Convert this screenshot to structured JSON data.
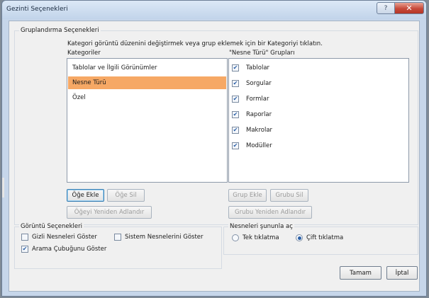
{
  "window": {
    "title": "Gezinti Seçenekleri",
    "help_glyph": "?",
    "close_glyph": "✕"
  },
  "grouping": {
    "section_label": "Gruplandırma Seçenekleri",
    "instructions": "Kategori görüntü düzenini değiştirmek veya grup eklemek için bir Kategoriyi tıklatın.",
    "categories_header": "Kategoriler",
    "groups_header": "\"Nesne Türü\" Grupları",
    "categories": [
      {
        "label": "Tablolar ve İlgili Görünümler",
        "selected": false
      },
      {
        "label": "Nesne Türü",
        "selected": true
      },
      {
        "label": "Özel",
        "selected": false
      }
    ],
    "groups": [
      {
        "label": "Tablolar",
        "checked": true
      },
      {
        "label": "Sorgular",
        "checked": true
      },
      {
        "label": "Formlar",
        "checked": true
      },
      {
        "label": "Raporlar",
        "checked": true
      },
      {
        "label": "Makrolar",
        "checked": true
      },
      {
        "label": "Modüller",
        "checked": true
      }
    ],
    "buttons": {
      "add_item": "Öğe Ekle",
      "delete_item": "Öğe Sil",
      "rename_item": "Öğeyi Yeniden Adlandır",
      "add_group": "Grup Ekle",
      "delete_group": "Grubu Sil",
      "rename_group": "Grubu Yeniden Adlandır"
    }
  },
  "display": {
    "section_label": "Görüntü Seçenekleri",
    "show_hidden": {
      "label": "Gizli Nesneleri Göster",
      "checked": false
    },
    "show_system": {
      "label": "Sistem Nesnelerini Göster",
      "checked": false
    },
    "show_search": {
      "label": "Arama Çubuğunu Göster",
      "checked": true
    }
  },
  "open_with": {
    "section_label": "Nesneleri şununla aç",
    "single_click": {
      "label": "Tek tıklatma",
      "selected": false
    },
    "double_click": {
      "label": "Çift tıklatma",
      "selected": true
    }
  },
  "footer": {
    "ok": "Tamam",
    "cancel": "İptal"
  },
  "colors": {
    "selection": "#f6a865",
    "check": "#2a5fa6",
    "close": "#c7493a"
  }
}
